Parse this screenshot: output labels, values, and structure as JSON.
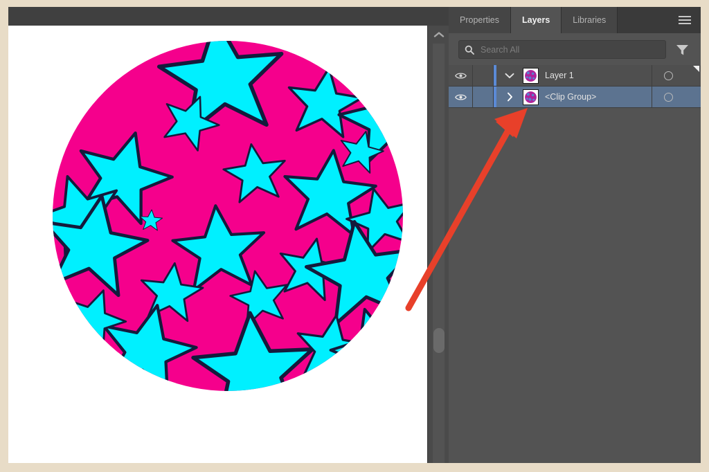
{
  "window": {
    "frame_color": "#e8dcc7",
    "chrome_color": "#3e3e3e"
  },
  "canvas": {
    "background": "#ffffff",
    "scrollbar": {
      "up_arrow_icon": "chevron-up-icon",
      "thumb_label": "scroll-thumb"
    },
    "artwork": {
      "name": "clipped-star-pattern",
      "circle_fill": "#F5008C",
      "star_fill": "#00F0FF",
      "stroke": "#141b3c",
      "description": "Magenta circle clipping a field of cyan stars"
    }
  },
  "panel": {
    "tabs": [
      {
        "label": "Properties",
        "active": false
      },
      {
        "label": "Layers",
        "active": true
      },
      {
        "label": "Libraries",
        "active": false
      }
    ],
    "menu_icon": "hamburger-menu-icon",
    "search": {
      "icon": "search-icon",
      "value": "",
      "placeholder": "Search All"
    },
    "filter_icon": "filter-funnel-icon",
    "layers": [
      {
        "name": "Layer 1",
        "visibility_icon": "eye-icon",
        "visible": true,
        "disclosure_icon": "chevron-down-icon",
        "expanded": true,
        "selected": false,
        "selection_bar": true,
        "target_icon": "target-circle-icon",
        "thumbnail": "clip-group-thumbnail",
        "indent": 0,
        "corner_marker": true
      },
      {
        "name": "<Clip Group>",
        "visibility_icon": "eye-icon",
        "visible": true,
        "disclosure_icon": "chevron-right-icon",
        "expanded": false,
        "selected": true,
        "selection_bar": true,
        "target_icon": "target-circle-icon",
        "thumbnail": "clip-group-thumbnail",
        "indent": 1,
        "corner_marker": false
      }
    ]
  },
  "annotation": {
    "arrow_color": "#e8402a",
    "arrow_name": "red-callout-arrow",
    "points_to": "chevron-right-icon"
  },
  "colors": {
    "accent_blue": "#5b8ad6",
    "selected_row": "#5c7390",
    "panel_bg": "#535353",
    "magenta": "#F5008C",
    "cyan": "#00F0FF"
  }
}
